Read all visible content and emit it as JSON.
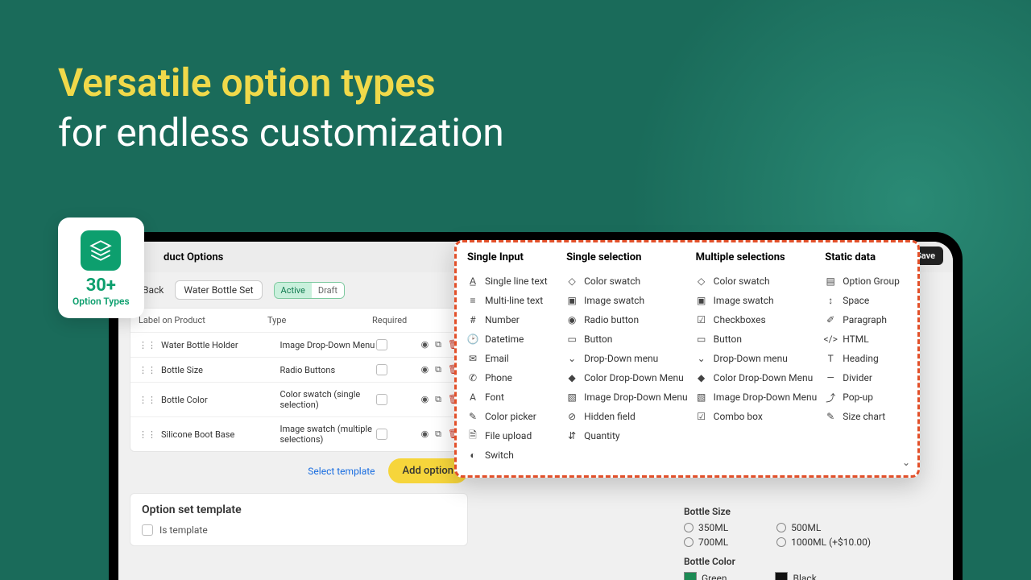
{
  "headline": {
    "line1": "Versatile option types",
    "line2": "for endless customization"
  },
  "badge": {
    "count": "30+",
    "sub": "Option Types"
  },
  "topbar": {
    "title": "duct Options",
    "title_prefix": "Product Options",
    "save": "Save"
  },
  "nav": {
    "back": "Back",
    "set_name": "Water Bottle Set",
    "active": "Active",
    "draft": "Draft"
  },
  "table": {
    "headers": {
      "label": "Label on Product",
      "type": "Type",
      "required": "Required"
    },
    "rows": [
      {
        "label": "Water Bottle Holder",
        "type": "Image Drop-Down Menu"
      },
      {
        "label": "Bottle Size",
        "type": "Radio Buttons"
      },
      {
        "label": "Bottle Color",
        "type": "Color swatch (single selection)"
      },
      {
        "label": "Silicone Boot Base",
        "type": "Image swatch (multiple selections)"
      }
    ]
  },
  "actions": {
    "select_template": "Select template",
    "add_option": "Add option"
  },
  "template_card": {
    "title": "Option set template",
    "is_template": "Is template"
  },
  "panel": {
    "size_title": "Bottle Size",
    "size_opts": [
      "350ML",
      "500ML",
      "700ML",
      "1000ML (+$10.00)"
    ],
    "color_title": "Bottle Color",
    "colors": [
      {
        "name": "Green",
        "hex": "#1c8a54"
      },
      {
        "name": "Black",
        "hex": "#111111"
      }
    ]
  },
  "popover": {
    "columns": [
      {
        "title": "Single Input",
        "items": [
          {
            "icon": "text",
            "label": "Single line text"
          },
          {
            "icon": "lines",
            "label": "Multi-line text"
          },
          {
            "icon": "hash",
            "label": "Number"
          },
          {
            "icon": "clock",
            "label": "Datetime"
          },
          {
            "icon": "mail",
            "label": "Email"
          },
          {
            "icon": "phone",
            "label": "Phone"
          },
          {
            "icon": "font",
            "label": "Font"
          },
          {
            "icon": "picker",
            "label": "Color picker"
          },
          {
            "icon": "file",
            "label": "File upload"
          },
          {
            "icon": "switch",
            "label": "Switch"
          }
        ]
      },
      {
        "title": "Single selection",
        "items": [
          {
            "icon": "swatch",
            "label": "Color swatch"
          },
          {
            "icon": "imgsw",
            "label": "Image swatch"
          },
          {
            "icon": "radio",
            "label": "Radio button"
          },
          {
            "icon": "btn",
            "label": "Button"
          },
          {
            "icon": "chev",
            "label": "Drop-Down menu"
          },
          {
            "icon": "cdrop",
            "label": "Color Drop-Down Menu"
          },
          {
            "icon": "idrop",
            "label": "Image Drop-Down Menu"
          },
          {
            "icon": "eyeoff",
            "label": "Hidden field"
          },
          {
            "icon": "qty",
            "label": "Quantity"
          }
        ]
      },
      {
        "title": "Multiple selections",
        "items": [
          {
            "icon": "swatch",
            "label": "Color swatch"
          },
          {
            "icon": "imgsw",
            "label": "Image swatch"
          },
          {
            "icon": "check",
            "label": "Checkboxes"
          },
          {
            "icon": "btn",
            "label": "Button"
          },
          {
            "icon": "chev",
            "label": "Drop-Down menu"
          },
          {
            "icon": "cdrop",
            "label": "Color Drop-Down Menu"
          },
          {
            "icon": "idrop",
            "label": "Image Drop-Down Menu"
          },
          {
            "icon": "combo",
            "label": "Combo box"
          }
        ]
      },
      {
        "title": "Static data",
        "items": [
          {
            "icon": "group",
            "label": "Option Group"
          },
          {
            "icon": "space",
            "label": "Space"
          },
          {
            "icon": "para",
            "label": "Paragraph"
          },
          {
            "icon": "html",
            "label": "HTML"
          },
          {
            "icon": "head",
            "label": "Heading"
          },
          {
            "icon": "div",
            "label": "Divider"
          },
          {
            "icon": "pop",
            "label": "Pop-up"
          },
          {
            "icon": "size",
            "label": "Size chart"
          }
        ]
      }
    ]
  }
}
